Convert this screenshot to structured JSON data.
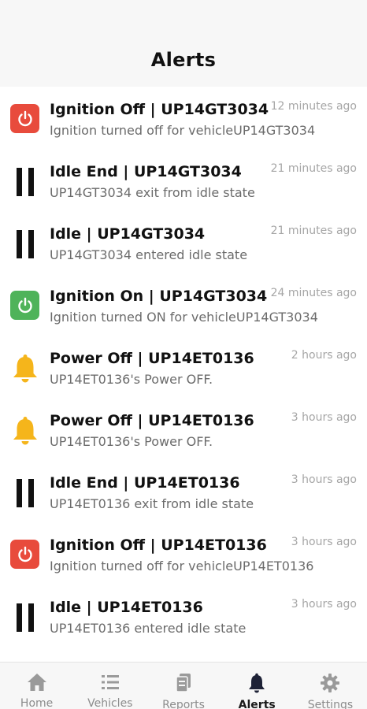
{
  "header": {
    "title": "Alerts"
  },
  "alerts": [
    {
      "icon": "power-icon",
      "icon_color": "#e84b3c",
      "title": "Ignition Off | UP14GT3034",
      "time": "12 minutes ago",
      "description": "Ignition turned off for vehicleUP14GT3034"
    },
    {
      "icon": "pause-icon",
      "title": "Idle End | UP14GT3034",
      "time": "21 minutes ago",
      "description": "UP14GT3034 exit from idle state"
    },
    {
      "icon": "pause-icon",
      "title": "Idle | UP14GT3034",
      "time": "21 minutes ago",
      "description": "UP14GT3034 entered idle state"
    },
    {
      "icon": "power-icon",
      "icon_color": "#4fb35a",
      "title": "Ignition On | UP14GT3034",
      "time": "24 minutes ago",
      "description": "Ignition turned ON for vehicleUP14GT3034"
    },
    {
      "icon": "bell-icon",
      "icon_color": "#f5b51b",
      "title": "Power Off | UP14ET0136",
      "time": "2 hours ago",
      "description": "UP14ET0136's Power OFF."
    },
    {
      "icon": "bell-icon",
      "icon_color": "#f5b51b",
      "title": "Power Off | UP14ET0136",
      "time": "3 hours ago",
      "description": "UP14ET0136's Power OFF."
    },
    {
      "icon": "pause-icon",
      "title": "Idle End | UP14ET0136",
      "time": "3 hours ago",
      "description": "UP14ET0136 exit from idle state"
    },
    {
      "icon": "power-icon",
      "icon_color": "#e84b3c",
      "title": "Ignition Off | UP14ET0136",
      "time": "3 hours ago",
      "description": "Ignition turned off for vehicleUP14ET0136"
    },
    {
      "icon": "pause-icon",
      "title": "Idle | UP14ET0136",
      "time": "3 hours ago",
      "description": "UP14ET0136 entered idle state"
    }
  ],
  "tab_bar": {
    "tabs": [
      {
        "label": "Home",
        "icon": "home-icon",
        "active": false
      },
      {
        "label": "Vehicles",
        "icon": "list-icon",
        "active": false
      },
      {
        "label": "Reports",
        "icon": "reports-icon",
        "active": false
      },
      {
        "label": "Alerts",
        "icon": "bell-icon",
        "active": true
      },
      {
        "label": "Settings",
        "icon": "gear-icon",
        "active": false
      }
    ]
  },
  "colors": {
    "active_tab": "#1a1a1a",
    "inactive_tab": "#8c8c8c",
    "time_text": "#a6a6a6"
  }
}
